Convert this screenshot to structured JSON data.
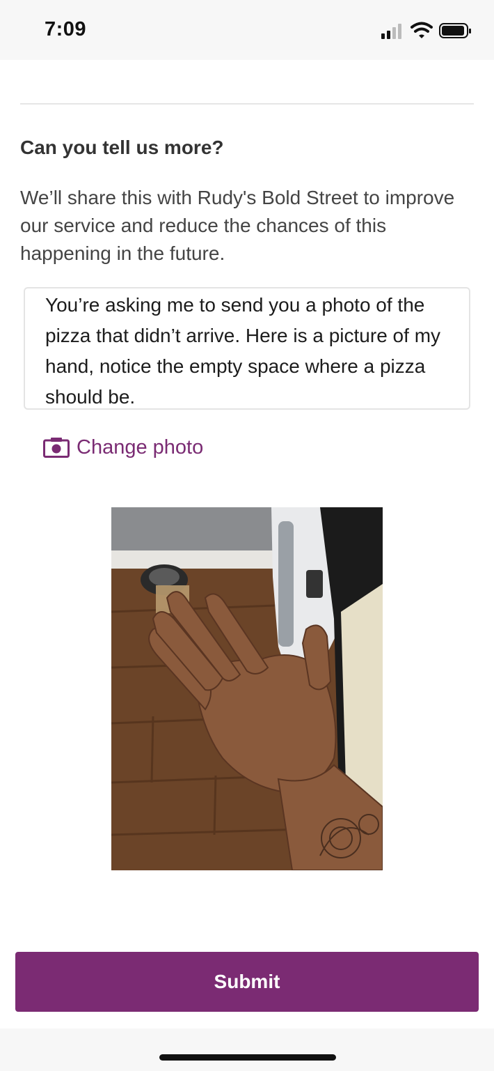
{
  "status_bar": {
    "time": "7:09",
    "icons": [
      "signal-icon",
      "wifi-icon",
      "battery-icon"
    ]
  },
  "form": {
    "heading": "Can you tell us more?",
    "description": "We’ll share this with Rudy's Bold Street to improve our service and reduce the chances of this happening in the future.",
    "feedback_text": "You’re asking me to send you a photo of the pizza that didn’t arrive. Here is a picture of my hand, notice the empty space where a pizza should be.",
    "change_photo_label": "Change photo",
    "change_photo_icon": "camera-icon",
    "submit_label": "Submit"
  },
  "colors": {
    "accent": "#7b2b73",
    "link": "#7a2b73",
    "text": "#3a3a3a",
    "background": "#ffffff"
  }
}
